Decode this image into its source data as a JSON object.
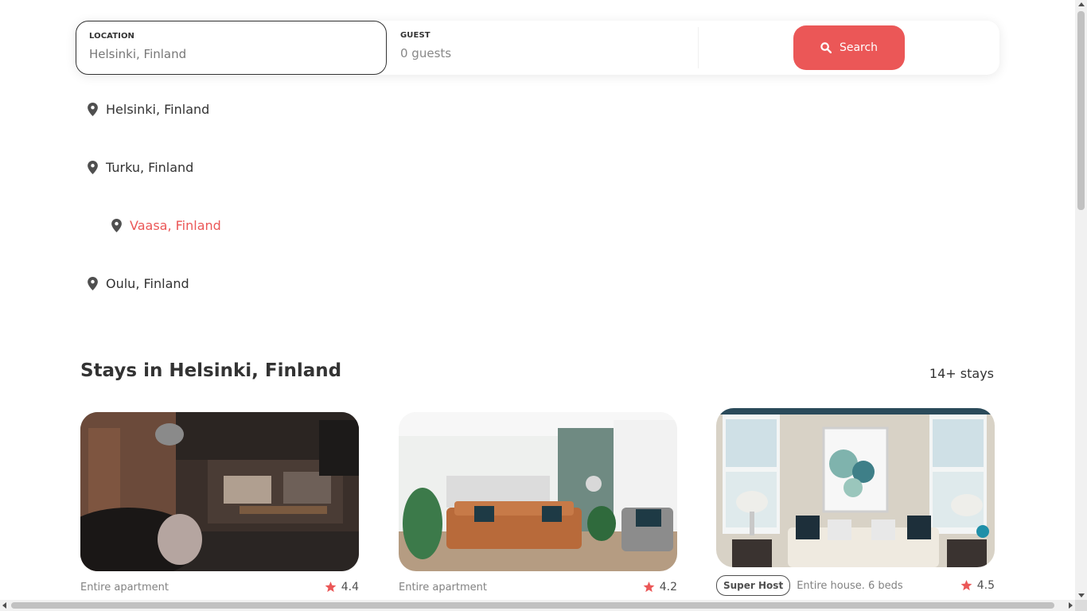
{
  "search": {
    "location_label": "LOCATION",
    "location_value": "Helsinki, Finland",
    "guest_label": "GUEST",
    "guest_placeholder": "0 guests",
    "button_label": "Search",
    "accent_color": "#eb5757"
  },
  "locations": [
    {
      "label": "Helsinki, Finland",
      "icon": "location-pin-icon"
    },
    {
      "label": "Turku, Finland",
      "icon": "location-pin-icon"
    },
    {
      "label": "Vaasa, Finland",
      "icon": "location-pin-icon",
      "highlighted": true
    },
    {
      "label": "Oulu, Finland",
      "icon": "location-pin-icon"
    }
  ],
  "stays": {
    "title": "Stays in Helsinki, Finland",
    "count": "14+ stays",
    "cards": [
      {
        "type": "Entire apartment",
        "rating": "4.4",
        "superhost": false,
        "photo": "loft-living-room-photo"
      },
      {
        "type": "Entire apartment",
        "rating": "4.2",
        "superhost": false,
        "photo": "bright-living-room-photo"
      },
      {
        "badge": "Super Host",
        "type": "Entire house. 6 beds",
        "rating": "4.5",
        "superhost": true,
        "photo": "white-sofa-living-room-photo"
      }
    ]
  }
}
